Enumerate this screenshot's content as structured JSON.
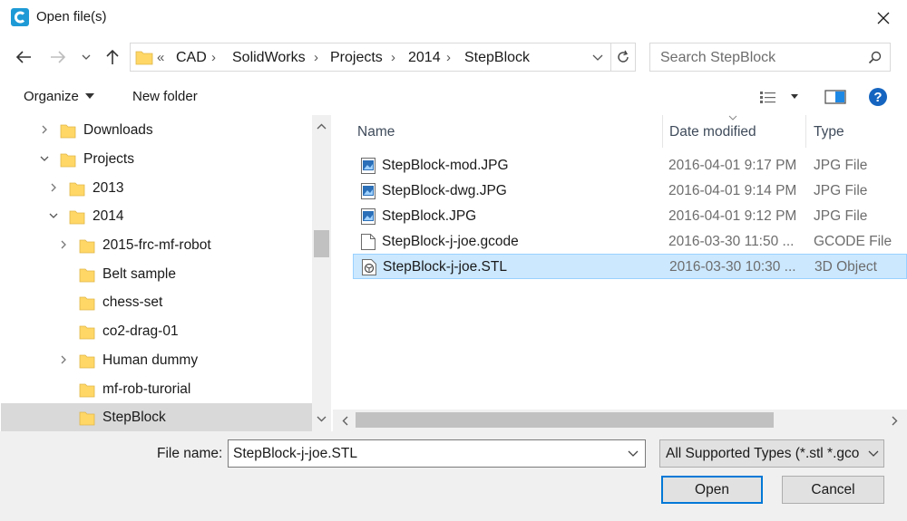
{
  "window": {
    "title": "Open file(s)"
  },
  "address": {
    "overflow": "«",
    "crumbs": [
      "CAD",
      "SolidWorks",
      "Projects",
      "2014",
      "StepBlock"
    ]
  },
  "search": {
    "placeholder": "Search StepBlock"
  },
  "toolbar": {
    "organize": "Organize",
    "new_folder": "New folder"
  },
  "tree": {
    "items": [
      {
        "label": "Downloads"
      },
      {
        "label": "Projects"
      },
      {
        "label": "2013"
      },
      {
        "label": "2014"
      },
      {
        "label": "2015-frc-mf-robot"
      },
      {
        "label": "Belt sample"
      },
      {
        "label": "chess-set"
      },
      {
        "label": "co2-drag-01"
      },
      {
        "label": "Human dummy"
      },
      {
        "label": "mf-rob-turorial"
      },
      {
        "label": "StepBlock"
      }
    ]
  },
  "list": {
    "columns": {
      "name": "Name",
      "date": "Date modified",
      "type": "Type"
    },
    "files": [
      {
        "name": "StepBlock-mod.JPG",
        "date": "2016-04-01 9:17 PM",
        "type": "JPG File",
        "icon": "image-file-icon"
      },
      {
        "name": "StepBlock-dwg.JPG",
        "date": "2016-04-01 9:14 PM",
        "type": "JPG File",
        "icon": "image-file-icon"
      },
      {
        "name": "StepBlock.JPG",
        "date": "2016-04-01 9:12 PM",
        "type": "JPG File",
        "icon": "image-file-icon"
      },
      {
        "name": "StepBlock-j-joe.gcode",
        "date": "2016-03-30 11:50 ...",
        "type": "GCODE File",
        "icon": "blank-file-icon"
      },
      {
        "name": "StepBlock-j-joe.STL",
        "date": "2016-03-30 10:30 ...",
        "type": "3D Object",
        "icon": "3d-object-file-icon",
        "selected": true
      }
    ]
  },
  "footer": {
    "file_name_label": "File name:",
    "file_name_value": "StepBlock-j-joe.STL",
    "file_type_value": "All Supported Types (*.stl *.gco",
    "open_label": "Open",
    "cancel_label": "Cancel"
  },
  "colors": {
    "accent": "#0078d7",
    "selection": "#cce8ff",
    "folder": "#ffd766"
  }
}
